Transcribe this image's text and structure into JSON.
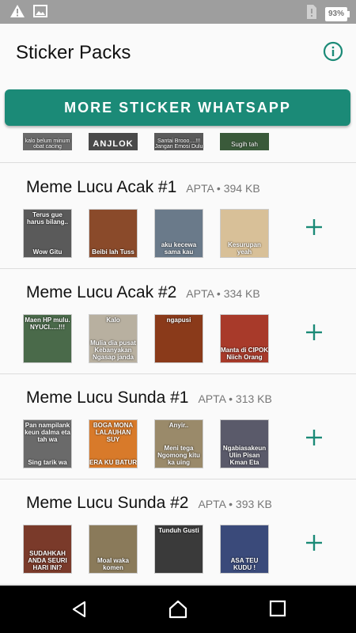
{
  "status_bar": {
    "battery": "93%"
  },
  "app_bar": {
    "title": "Sticker Packs"
  },
  "more_button": {
    "label": "MORE STICKER WHATSAPP"
  },
  "partial_row": {
    "captions": [
      "kalo belum minum obat cacing",
      "ANJLOK",
      "Santai Brooo....!!! Jangan Emosi Dulu",
      "Sugih tah"
    ]
  },
  "packs": [
    {
      "name": "Meme Lucu Acak #1",
      "author": "APTA",
      "size": "394 KB",
      "thumbs": [
        {
          "top": "Terus gue harus bilang..",
          "bot": "Wow Gitu",
          "bg": "#5a5a5a"
        },
        {
          "top": "",
          "bot": "Beibi lah Tuss",
          "bg": "#8a4a2a"
        },
        {
          "top": "",
          "bot": "aku kecewa sama kau",
          "bg": "#6a7a8a"
        },
        {
          "top": "",
          "bot": "Kesurupan yeah",
          "bg": "#d8c098"
        }
      ]
    },
    {
      "name": "Meme Lucu Acak #2",
      "author": "APTA",
      "size": "334 KB",
      "thumbs": [
        {
          "top": "Maen HP mulu. NYUCI.....!!!",
          "bot": "",
          "bg": "#4a6a4a"
        },
        {
          "top": "Kalo",
          "bot": "Mulia dia pusat Kebanyakan Ngasap janda",
          "bg": "#b8b0a0"
        },
        {
          "top": "ngapusi",
          "bot": "",
          "bg": "#8a3a1a"
        },
        {
          "top": "",
          "bot": "Manta di CIPOK Niich Orang",
          "bg": "#a83a2a"
        }
      ]
    },
    {
      "name": "Meme Lucu Sunda #1",
      "author": "APTA",
      "size": "313 KB",
      "thumbs": [
        {
          "top": "Pan nampilank keun dalma eta tah wa",
          "bot": "Sing tarik wa",
          "bg": "#6a6a6a"
        },
        {
          "top": "BOGA MONA LALAUHAN SUY",
          "bot": "ERA KU BATUR",
          "bg": "#d87a2a"
        },
        {
          "top": "Anyir..",
          "bot": "Meni tega Ngomong kitu ka uing",
          "bg": "#9a8a6a"
        },
        {
          "top": "",
          "bot": "Ngabiasakeun Ulin Pisan Kman Eta",
          "bg": "#5a5a6a"
        }
      ]
    },
    {
      "name": "Meme Lucu Sunda #2",
      "author": "APTA",
      "size": "393 KB",
      "thumbs": [
        {
          "top": "",
          "bot": "SUDAHKAH ANDA SEURI HARI INI?",
          "bg": "#7a3a2a"
        },
        {
          "top": "",
          "bot": "Moal waka komen",
          "bg": "#8a7a5a"
        },
        {
          "top": "Tunduh Gusti",
          "bot": "",
          "bg": "#3a3a3a"
        },
        {
          "top": "",
          "bot": "ASA TEU KUDU !",
          "bg": "#3a4a7a"
        }
      ]
    }
  ],
  "colors": {
    "accent": "#1b8a77",
    "status": "#9e9e9e",
    "nav": "#000000"
  }
}
